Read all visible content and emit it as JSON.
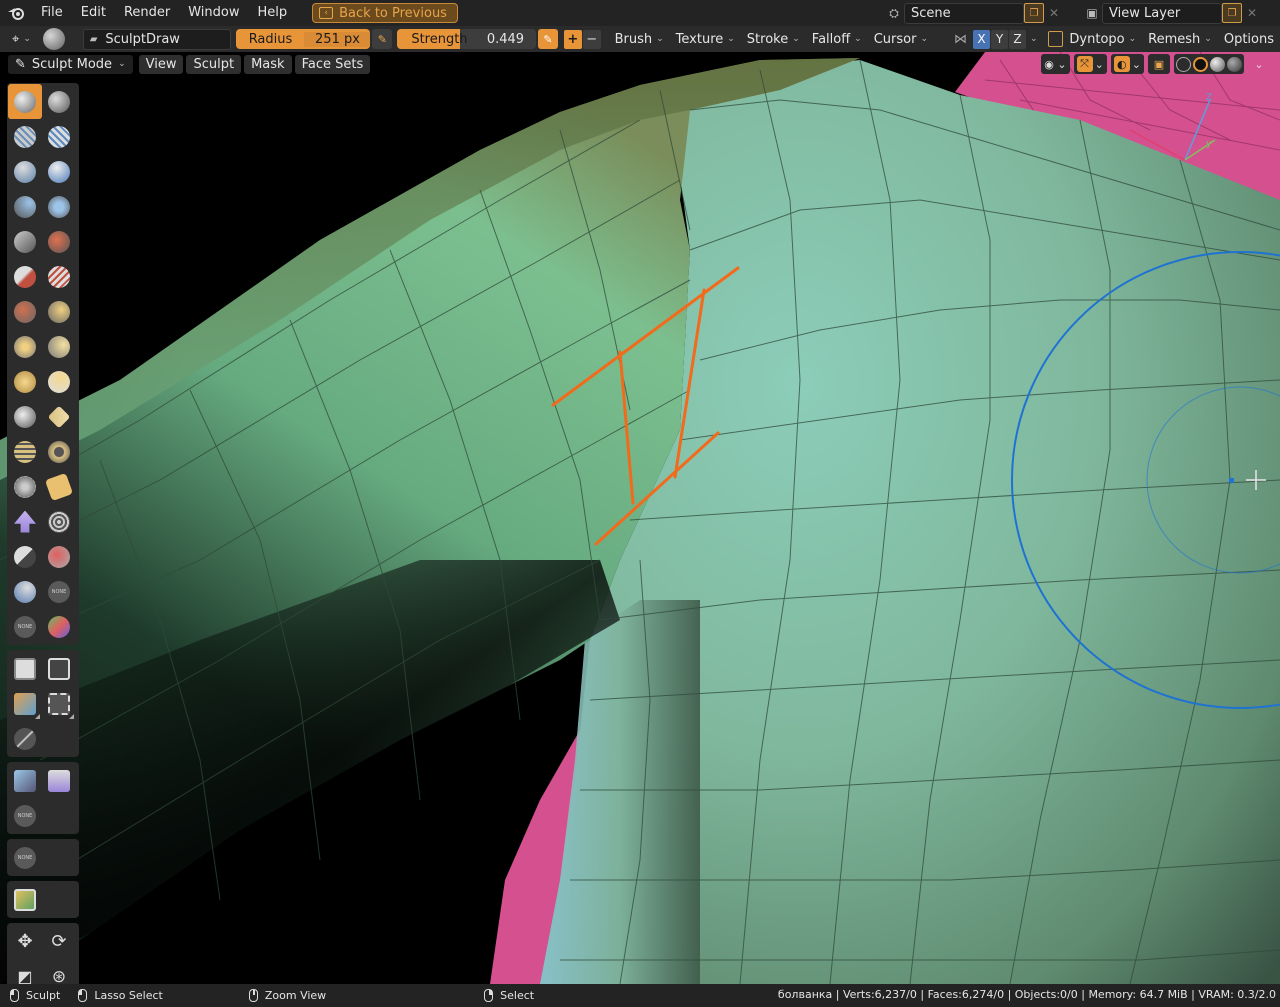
{
  "menubar": {
    "items": [
      "File",
      "Edit",
      "Render",
      "Window",
      "Help"
    ],
    "back_button": "Back to Previous",
    "scene": "Scene",
    "view_layer": "View Layer"
  },
  "tool_header": {
    "brush_name": "SculptDraw",
    "radius_label": "Radius",
    "radius_value": "251 px",
    "strength_label": "Strength",
    "strength_value": "0.449",
    "strength_fraction": 0.449,
    "menus": [
      "Brush",
      "Texture",
      "Stroke",
      "Falloff",
      "Cursor"
    ],
    "axes": [
      "X",
      "Y",
      "Z"
    ],
    "dyntopo": "Dyntopo",
    "remesh": "Remesh",
    "options": "Options"
  },
  "mode_header": {
    "mode": "Sculpt Mode",
    "menus": [
      "View",
      "Sculpt",
      "Mask",
      "Face Sets"
    ]
  },
  "toolbar": {
    "none_label": "NONE"
  },
  "statusbar": {
    "mode": "Sculpt",
    "lasso": "Lasso Select",
    "zoom": "Zoom View",
    "select": "Select",
    "stats": "болванка | Verts:6,237/0 | Faces:6,274/0 | Objects:0/0 | Memory: 64.7 MiB | VRAM: 0.3/2.0"
  },
  "colors": {
    "accent_orange": "#e8953a",
    "active_blue": "#4772b3",
    "mesh_green": "#7fbf8f",
    "mesh_cyan": "#8cc8c4",
    "mesh_pink": "#d4508e",
    "brush_circle": "#1e73d2",
    "annotation": "#f26a1b"
  }
}
